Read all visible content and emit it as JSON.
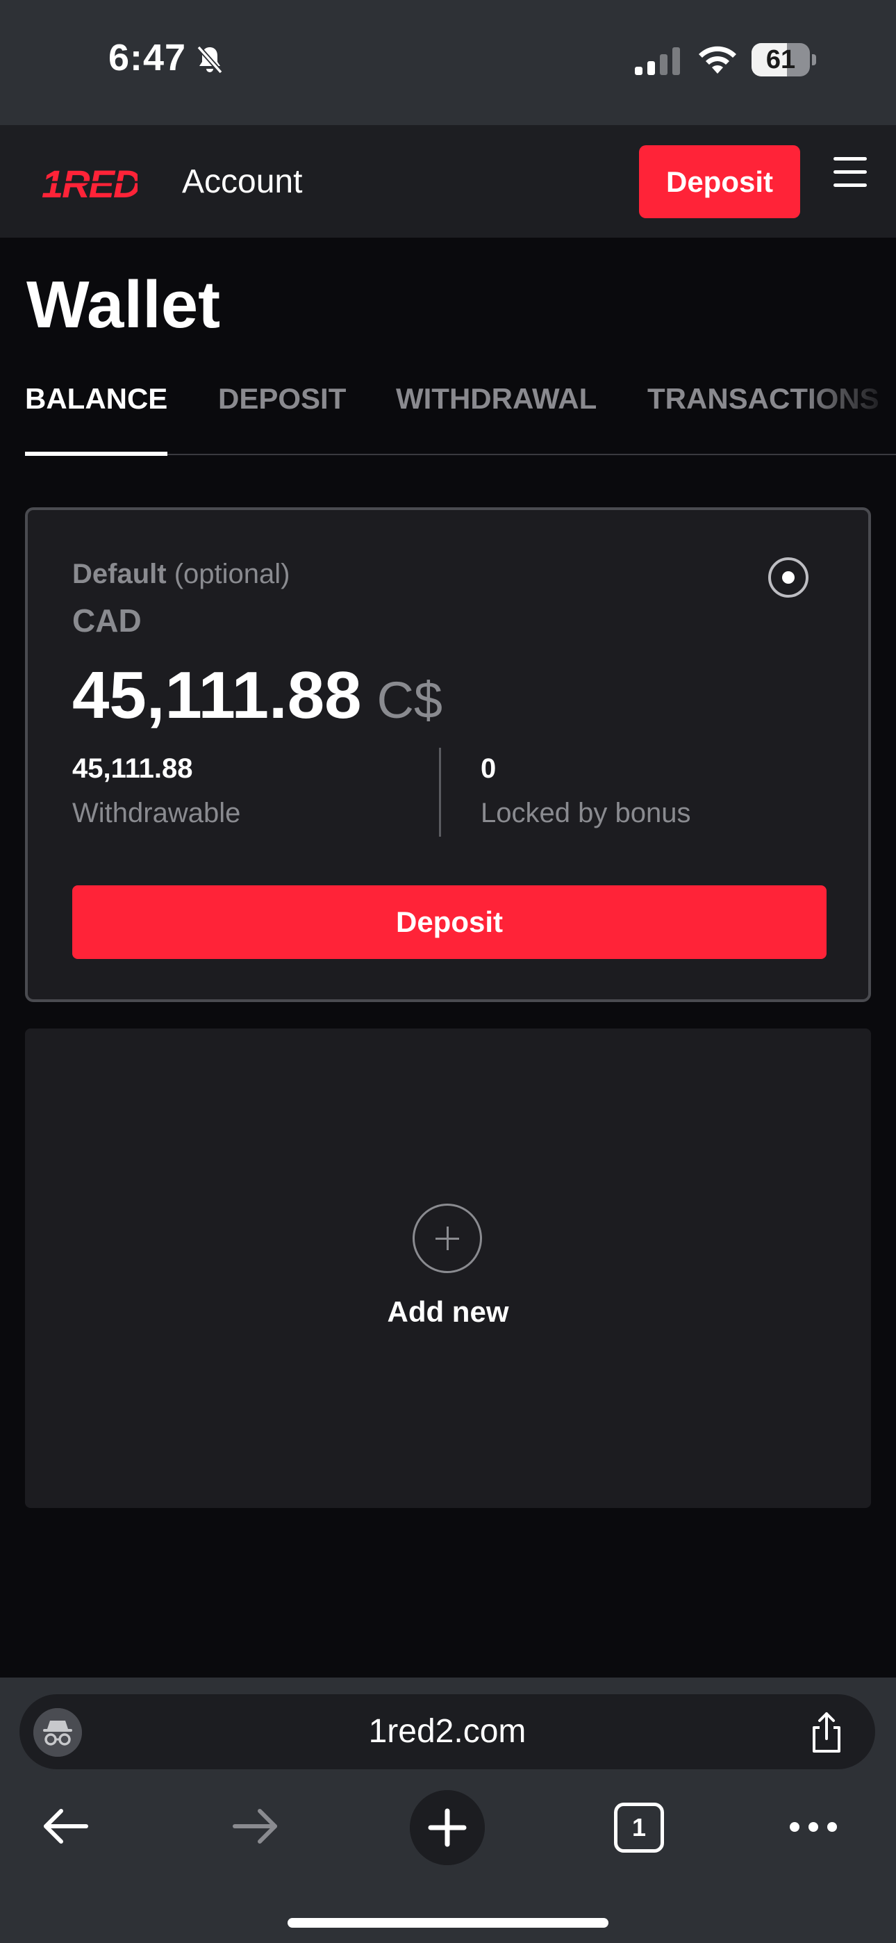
{
  "status_bar": {
    "time": "6:47",
    "battery": "61",
    "icons": [
      "bell-off-icon",
      "signal-icon",
      "wifi-icon",
      "battery-icon"
    ]
  },
  "header": {
    "logo_text": "RED",
    "account_label": "Account",
    "deposit_label": "Deposit",
    "menu_icon": "hamburger-menu-icon"
  },
  "page": {
    "title": "Wallet"
  },
  "tabs": [
    {
      "label": "BALANCE",
      "active": true
    },
    {
      "label": "DEPOSIT",
      "active": false
    },
    {
      "label": "WITHDRAWAL",
      "active": false
    },
    {
      "label": "TRANSACTIONS",
      "active": false
    }
  ],
  "wallet": {
    "default_label": "Default",
    "optional_label": "(optional)",
    "currency": "CAD",
    "amount": "45,111.88",
    "currency_symbol": "C$",
    "withdrawable_value": "45,111.88",
    "withdrawable_label": "Withdrawable",
    "locked_value": "0",
    "locked_label": "Locked by bonus",
    "deposit_label": "Deposit"
  },
  "add_wallet": {
    "label": "Add new"
  },
  "browser": {
    "url": "1red2.com",
    "tab_count": "1"
  },
  "colors": {
    "accent": "#ff2338",
    "background": "#0a0a0d",
    "card": "#1c1c20"
  }
}
